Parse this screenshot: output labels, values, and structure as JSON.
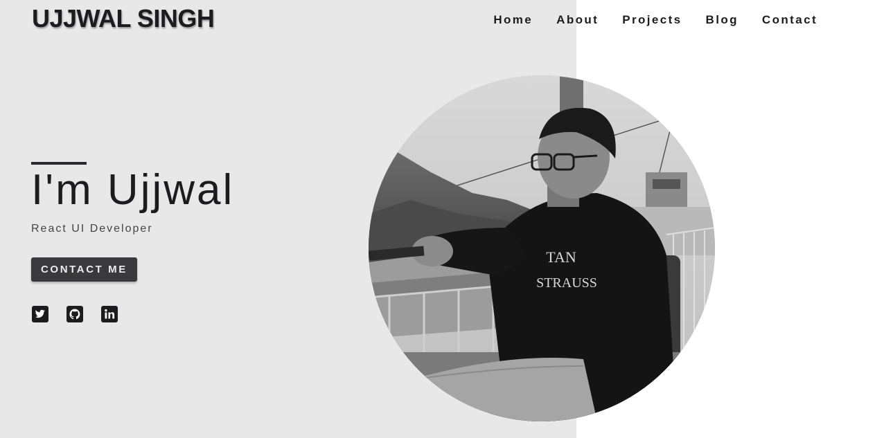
{
  "brand": {
    "name": "UJJWAL SINGH"
  },
  "nav": {
    "items": [
      {
        "label": "Home"
      },
      {
        "label": "About"
      },
      {
        "label": "Projects"
      },
      {
        "label": "Blog"
      },
      {
        "label": "Contact"
      }
    ]
  },
  "hero": {
    "title": "I'm Ujjwal",
    "subtitle": "React UI Developer",
    "cta_label": "CONTACT ME"
  },
  "socials": [
    {
      "icon": "twitter-icon"
    },
    {
      "icon": "github-icon"
    },
    {
      "icon": "linkedin-icon"
    }
  ],
  "portrait": {
    "shirt_text_line1": "TAN",
    "shirt_text_line2": "STRAUSS"
  },
  "colors": {
    "left_background": "#e8e8e8",
    "right_background": "#ffffff",
    "text": "#1c1c1e",
    "button_background": "#3a3a3d",
    "button_text": "#ececec"
  }
}
